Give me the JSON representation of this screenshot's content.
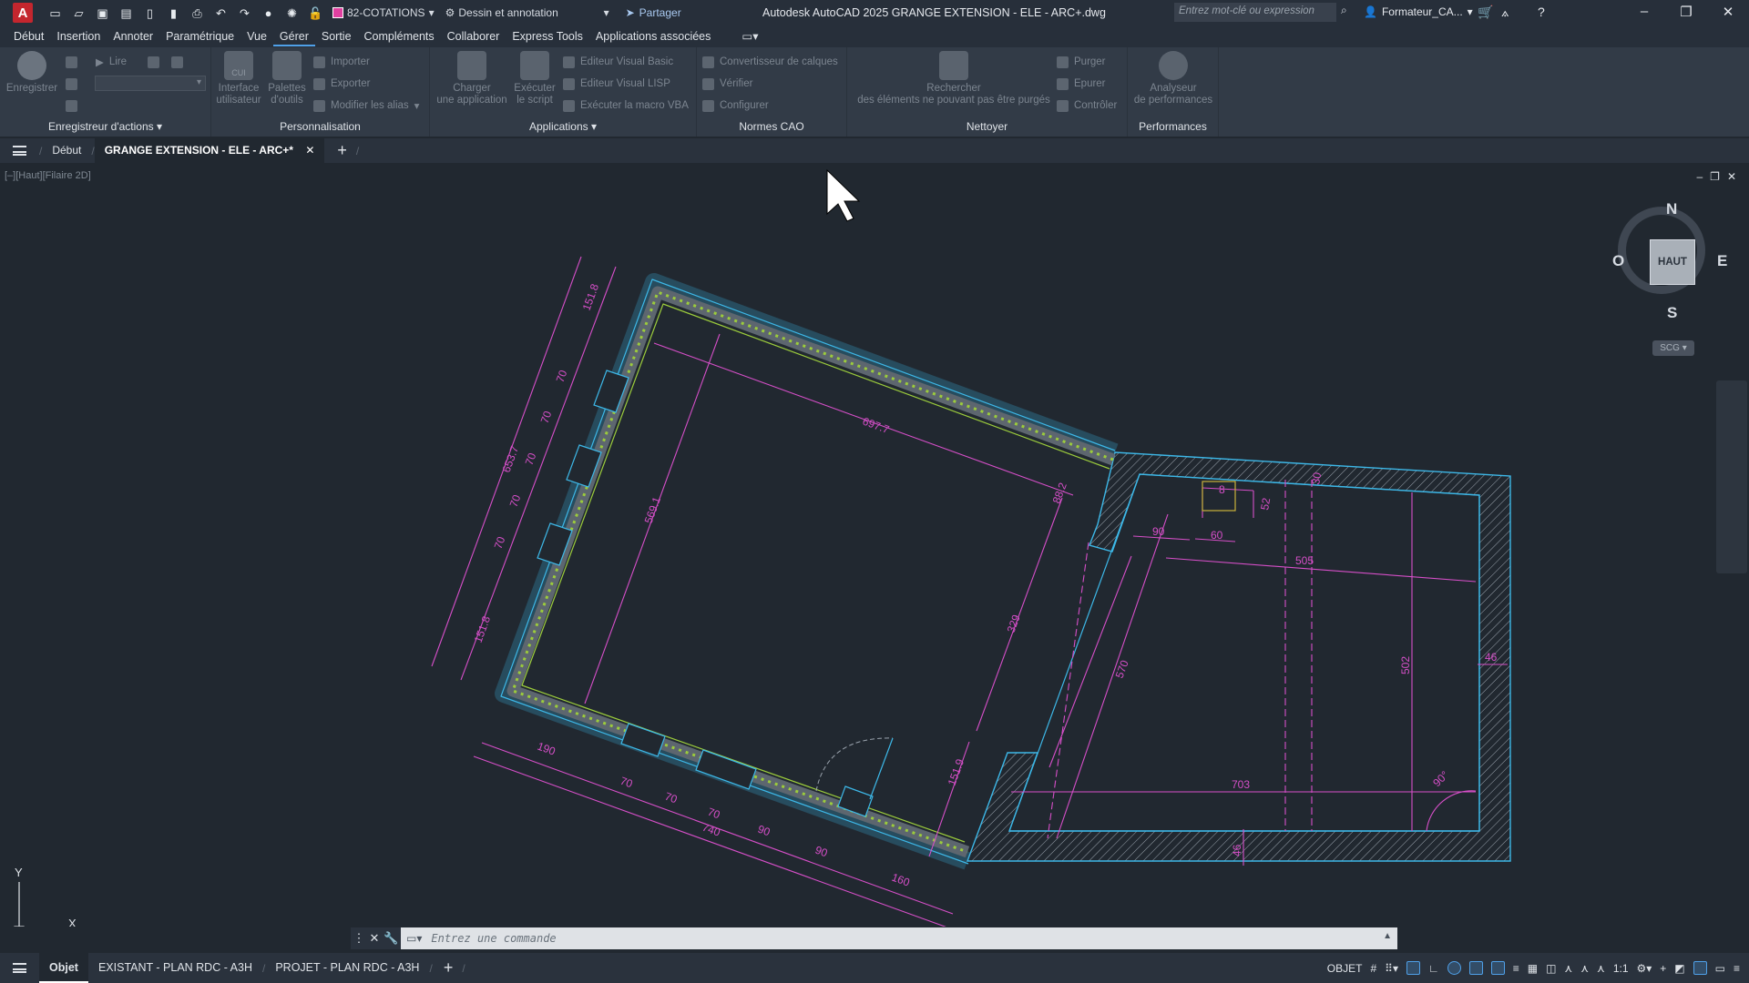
{
  "titlebar": {
    "app_letter": "A",
    "layer": "82-COTATIONS",
    "workspace": "Dessin et annotation",
    "share": "Partager",
    "title": "Autodesk AutoCAD 2025    GRANGE EXTENSION - ELE - ARC+.dwg",
    "search_placeholder": "Entrez mot-clé ou expression",
    "user": "Formateur_CA..."
  },
  "menu": [
    "Début",
    "Insertion",
    "Annoter",
    "Paramétrique",
    "Vue",
    "Gérer",
    "Sortie",
    "Compléments",
    "Collaborer",
    "Express Tools",
    "Applications associées"
  ],
  "ribbon": {
    "panels": {
      "actions": "Enregistreur d'actions",
      "perso": "Personnalisation",
      "apps": "Applications",
      "cao": "Normes CAO",
      "clean": "Nettoyer",
      "perf": "Performances"
    },
    "buttons": {
      "enregistrer": "Enregistrer",
      "lire": "Lire",
      "cui_tag": "CUI",
      "interface_1": "Interface",
      "interface_2": "utilisateur",
      "palettes_1": "Palettes",
      "palettes_2": "d'outils",
      "importer": "Importer",
      "exporter": "Exporter",
      "alias": "Modifier les alias",
      "charger_1": "Charger",
      "charger_2": "une application",
      "exec_1": "Exécuter",
      "exec_2": "le script",
      "vb": "Editeur Visual Basic",
      "lisp": "Editeur Visual LISP",
      "vba": "Exécuter la macro VBA",
      "calques": "Convertisseur de calques",
      "verifier": "Vérifier",
      "configurer": "Configurer",
      "rech_1": "Rechercher",
      "rech_2": "des éléments ne pouvant pas être purgés",
      "purger": "Purger",
      "epurer": "Epurer",
      "controler": "Contrôler",
      "analy_1": "Analyseur",
      "analy_2": "de performances"
    }
  },
  "doctabs": {
    "start": "Début",
    "active": "GRANGE EXTENSION - ELE - ARC+*"
  },
  "viewport": {
    "label": "[–][Haut][Filaire 2D]",
    "cube_face": "HAUT",
    "n": "N",
    "s": "S",
    "e": "E",
    "o": "O",
    "ucs": "SCG"
  },
  "drawing": {
    "dims": [
      "151.8",
      "70",
      "70",
      "70",
      "70",
      "70",
      "151.8",
      "653.7",
      "697.7",
      "569.1",
      "88.2",
      "329",
      "151.9",
      "190",
      "70",
      "70",
      "70",
      "90",
      "90",
      "160",
      "740",
      "8",
      "52",
      "30",
      "90",
      "60",
      "505",
      "502",
      "570",
      "46",
      "703",
      "90°",
      "46"
    ]
  },
  "command": {
    "placeholder": "Entrez une commande"
  },
  "status": {
    "layouts": [
      "Objet",
      "EXISTANT - PLAN RDC - A3H",
      "PROJET - PLAN RDC - A3H"
    ],
    "mode": "OBJET",
    "scale": "1:1"
  },
  "colors": {
    "magenta": "#d64fc8",
    "cyan": "#3db8e8",
    "green": "#9ccc3c",
    "bg": "#212830"
  }
}
